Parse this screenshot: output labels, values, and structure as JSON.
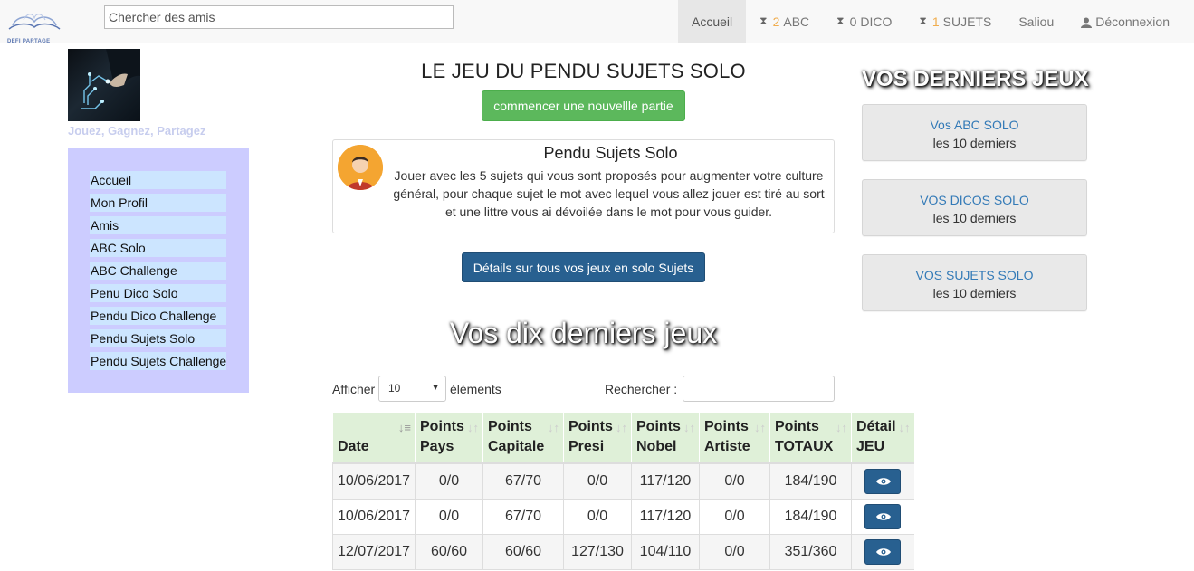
{
  "navbar": {
    "logo_text": "DEFI PARTAGE",
    "search_placeholder": "Chercher des amis",
    "items": [
      {
        "label": "Accueil",
        "count": ""
      },
      {
        "label": "ABC",
        "count": "2"
      },
      {
        "label": "DICO",
        "count": "0"
      },
      {
        "label": "SUJETS",
        "count": "1"
      },
      {
        "label": "Saliou",
        "count": ""
      },
      {
        "label": "Déconnexion",
        "count": ""
      }
    ]
  },
  "sidebar": {
    "tagline": "Jouez, Gagnez, Partagez",
    "items": [
      "Accueil",
      "Mon Profil",
      "Amis",
      "ABC Solo",
      "ABC Challenge",
      "Penu Dico Solo",
      "Pendu Dico Challenge",
      "Pendu Sujets Solo",
      "Pendu Sujets Challenge"
    ]
  },
  "main": {
    "title": "LE JEU DU PENDU SUJETS SOLO",
    "new_game_button": "commencer une nouvellle partie",
    "info": {
      "title": "Pendu Sujets Solo",
      "description": "Jouer avec les 5 sujets qui vous sont proposés pour augmenter votre culture général, pour chaque sujet le mot avec lequel vous allez jouer est tiré au sort et une littre vous ai dévoilée dans le mot pour vous guider."
    },
    "details_button": "Détails sur tous vos jeux en solo Sujets",
    "section_title": "Vos dix derniers jeux",
    "table_controls": {
      "show_label": "Afficher",
      "show_value": "10",
      "elements_label": "éléments",
      "search_label": "Rechercher :"
    },
    "table": {
      "headers": [
        {
          "line1": "",
          "line2": "Date"
        },
        {
          "line1": "Points",
          "line2": "Pays"
        },
        {
          "line1": "Points",
          "line2": "Capitale"
        },
        {
          "line1": "Points",
          "line2": "Presi"
        },
        {
          "line1": "Points",
          "line2": "Nobel"
        },
        {
          "line1": "Points",
          "line2": "Artiste"
        },
        {
          "line1": "Points",
          "line2": "TOTAUX"
        },
        {
          "line1": "Détail",
          "line2": "JEU"
        }
      ],
      "rows": [
        [
          "10/06/2017",
          "0/0",
          "67/70",
          "0/0",
          "117/120",
          "0/0",
          "184/190"
        ],
        [
          "10/06/2017",
          "0/0",
          "67/70",
          "0/0",
          "117/120",
          "0/0",
          "184/190"
        ],
        [
          "12/07/2017",
          "60/60",
          "60/60",
          "127/130",
          "104/110",
          "0/0",
          "351/360"
        ]
      ]
    }
  },
  "right": {
    "title": "VOS DERNIERS JEUX",
    "cards": [
      {
        "link": "Vos ABC SOLO",
        "sub": "les 10 derniers"
      },
      {
        "link": "VOS DICOS SOLO",
        "sub": "les 10 derniers"
      },
      {
        "link": "VOS SUJETS SOLO",
        "sub": "les 10 derniers"
      }
    ]
  }
}
